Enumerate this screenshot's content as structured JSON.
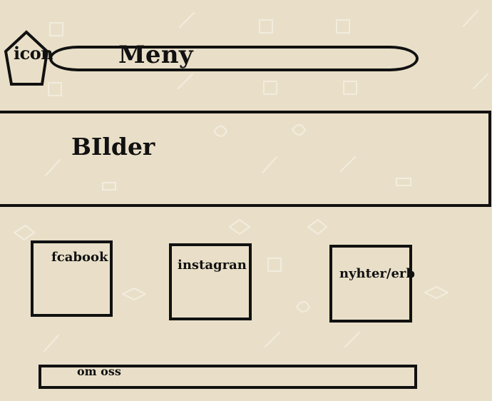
{
  "header": {
    "icon_label": "icon",
    "menu_label": "Meny"
  },
  "banner": {
    "label": "BIlder"
  },
  "tiles": [
    {
      "label": "fcabook"
    },
    {
      "label": "instagran"
    },
    {
      "label": "nyhter/erb"
    }
  ],
  "footer": {
    "about_label": "om oss"
  }
}
